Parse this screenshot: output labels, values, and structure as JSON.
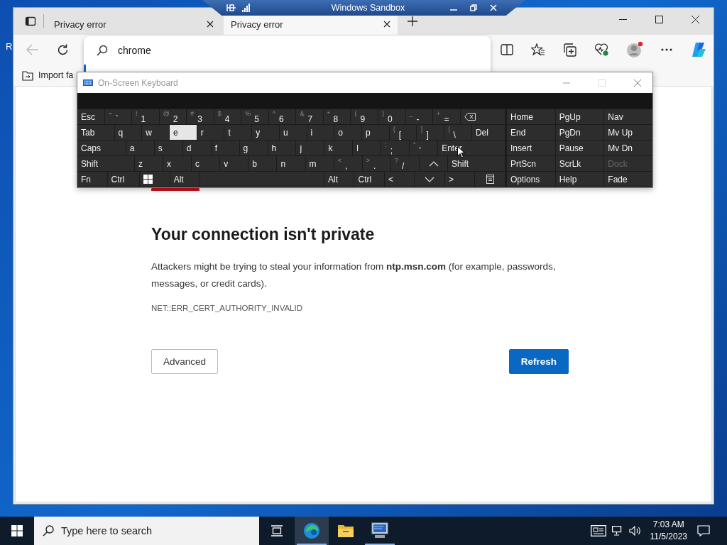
{
  "desktop": {
    "icon_label": "R"
  },
  "sandbox_bar": {
    "title": "Windows Sandbox"
  },
  "browser": {
    "tabs": [
      {
        "title": "Privacy error",
        "selected": false
      },
      {
        "title": "Privacy error",
        "selected": true
      }
    ],
    "address": {
      "value": "chrome"
    },
    "bookmarks": [
      {
        "label": "Import fa"
      }
    ],
    "page": {
      "heading": "Your connection isn't private",
      "message": "Attackers might be trying to steal your information from **ntp.msn.com** (for example, passwords, messages, or credit cards).",
      "error_code": "NET::ERR_CERT_AUTHORITY_INVALID",
      "buttons": [
        {
          "label": "Advanced",
          "kind": "secondary"
        },
        {
          "label": "Refresh",
          "kind": "primary"
        }
      ]
    }
  },
  "keyboard": {
    "title": "On-Screen Keyboard",
    "rows": [
      [
        {
          "kind": "key",
          "label": "Esc",
          "pressed": false
        },
        {
          "kind": "key",
          "label": "`",
          "shift": "~",
          "pressed": false
        },
        {
          "kind": "key",
          "label": "1",
          "shift": "!",
          "pressed": false
        },
        {
          "kind": "key",
          "label": "2",
          "shift": "@",
          "pressed": false
        },
        {
          "kind": "key",
          "label": "3",
          "shift": "#",
          "pressed": false
        },
        {
          "kind": "key",
          "label": "4",
          "shift": "$",
          "pressed": false
        },
        {
          "kind": "key",
          "label": "5",
          "shift": "%",
          "pressed": false
        },
        {
          "kind": "key",
          "label": "6",
          "shift": "^",
          "pressed": false
        },
        {
          "kind": "key",
          "label": "7",
          "shift": "&",
          "pressed": false
        },
        {
          "kind": "key",
          "label": "8",
          "shift": "*",
          "pressed": false
        },
        {
          "kind": "key",
          "label": "9",
          "shift": "(",
          "pressed": false
        },
        {
          "kind": "key",
          "label": "0",
          "shift": ")",
          "pressed": false
        },
        {
          "kind": "key",
          "label": "-",
          "shift": "_",
          "pressed": false
        },
        {
          "kind": "key",
          "label": "=",
          "shift": "+",
          "pressed": false
        },
        {
          "kind": "backspace",
          "pressed": false
        }
      ],
      [
        {
          "kind": "key",
          "label": "Tab",
          "pressed": false
        },
        {
          "kind": "key",
          "label": "q",
          "pressed": false
        },
        {
          "kind": "key",
          "label": "w",
          "pressed": false
        },
        {
          "kind": "key",
          "label": "e",
          "pressed": true
        },
        {
          "kind": "key",
          "label": "r",
          "pressed": false
        },
        {
          "kind": "key",
          "label": "t",
          "pressed": false
        },
        {
          "kind": "key",
          "label": "y",
          "pressed": false
        },
        {
          "kind": "key",
          "label": "u",
          "pressed": false
        },
        {
          "kind": "key",
          "label": "i",
          "pressed": false
        },
        {
          "kind": "key",
          "label": "o",
          "pressed": false
        },
        {
          "kind": "key",
          "label": "p",
          "pressed": false
        },
        {
          "kind": "key",
          "label": "[",
          "shift": "{",
          "pressed": false
        },
        {
          "kind": "key",
          "label": "]",
          "shift": "}",
          "pressed": false
        },
        {
          "kind": "key",
          "label": "\\",
          "shift": "|",
          "pressed": false
        },
        {
          "kind": "key",
          "label": "Del",
          "pressed": false
        }
      ],
      [
        {
          "kind": "key",
          "label": "Caps",
          "pressed": false
        },
        {
          "kind": "key",
          "label": "a",
          "pressed": false
        },
        {
          "kind": "key",
          "label": "s",
          "pressed": false
        },
        {
          "kind": "key",
          "label": "d",
          "pressed": false
        },
        {
          "kind": "key",
          "label": "f",
          "pressed": false
        },
        {
          "kind": "key",
          "label": "g",
          "pressed": false
        },
        {
          "kind": "key",
          "label": "h",
          "pressed": false
        },
        {
          "kind": "key",
          "label": "j",
          "pressed": false
        },
        {
          "kind": "key",
          "label": "k",
          "pressed": false
        },
        {
          "kind": "key",
          "label": "l",
          "pressed": false
        },
        {
          "kind": "key",
          "label": ";",
          "shift": ":",
          "pressed": false
        },
        {
          "kind": "key",
          "label": "'",
          "shift": "\"",
          "pressed": false
        },
        {
          "kind": "key",
          "label": "Enter",
          "pressed": false
        }
      ],
      [
        {
          "kind": "key",
          "label": "Shift",
          "pressed": false
        },
        {
          "kind": "key",
          "label": "z",
          "pressed": false
        },
        {
          "kind": "key",
          "label": "x",
          "pressed": false
        },
        {
          "kind": "key",
          "label": "c",
          "pressed": false
        },
        {
          "kind": "key",
          "label": "v",
          "pressed": false
        },
        {
          "kind": "key",
          "label": "b",
          "pressed": false
        },
        {
          "kind": "key",
          "label": "n",
          "pressed": false
        },
        {
          "kind": "key",
          "label": "m",
          "pressed": false
        },
        {
          "kind": "key",
          "label": ",",
          "shift": "<",
          "pressed": false
        },
        {
          "kind": "key",
          "label": ".",
          "shift": ">",
          "pressed": false
        },
        {
          "kind": "key",
          "label": "/",
          "shift": "?",
          "pressed": false
        },
        {
          "kind": "up",
          "pressed": false
        },
        {
          "kind": "key",
          "label": "Shift",
          "pressed": false
        }
      ],
      [
        {
          "kind": "key",
          "label": "Fn",
          "pressed": false
        },
        {
          "kind": "key",
          "label": "Ctrl",
          "pressed": false
        },
        {
          "kind": "windows",
          "pressed": false
        },
        {
          "kind": "key",
          "label": "Alt",
          "pressed": false
        },
        {
          "kind": "space",
          "pressed": false
        },
        {
          "kind": "key",
          "label": "Alt",
          "pressed": false
        },
        {
          "kind": "key",
          "label": "Ctrl",
          "pressed": false
        },
        {
          "kind": "key",
          "label": "<",
          "pressed": false
        },
        {
          "kind": "down",
          "pressed": false
        },
        {
          "kind": "key",
          "label": ">",
          "pressed": false
        },
        {
          "kind": "menu",
          "pressed": false
        }
      ]
    ],
    "side_keys": [
      {
        "label": "Home",
        "disabled": false
      },
      {
        "label": "PgUp",
        "disabled": false
      },
      {
        "label": "Nav",
        "disabled": false
      },
      {
        "label": "End",
        "disabled": false
      },
      {
        "label": "PgDn",
        "disabled": false
      },
      {
        "label": "Mv Up",
        "disabled": false
      },
      {
        "label": "Insert",
        "disabled": false
      },
      {
        "label": "Pause",
        "disabled": false
      },
      {
        "label": "Mv Dn",
        "disabled": false
      },
      {
        "label": "PrtScn",
        "disabled": false
      },
      {
        "label": "ScrLk",
        "disabled": false
      },
      {
        "label": "Dock",
        "disabled": true
      },
      {
        "label": "Options",
        "disabled": false
      },
      {
        "label": "Help",
        "disabled": false
      },
      {
        "label": "Fade",
        "disabled": false
      }
    ]
  },
  "taskbar": {
    "search_placeholder": "Type here to search",
    "apps": [
      {
        "kind": "edge",
        "running": true,
        "active": true
      },
      {
        "kind": "folder",
        "running": false,
        "active": false
      },
      {
        "kind": "monitor",
        "running": true,
        "active": false
      }
    ],
    "time": "7:03 AM",
    "date": "11/5/2023"
  }
}
